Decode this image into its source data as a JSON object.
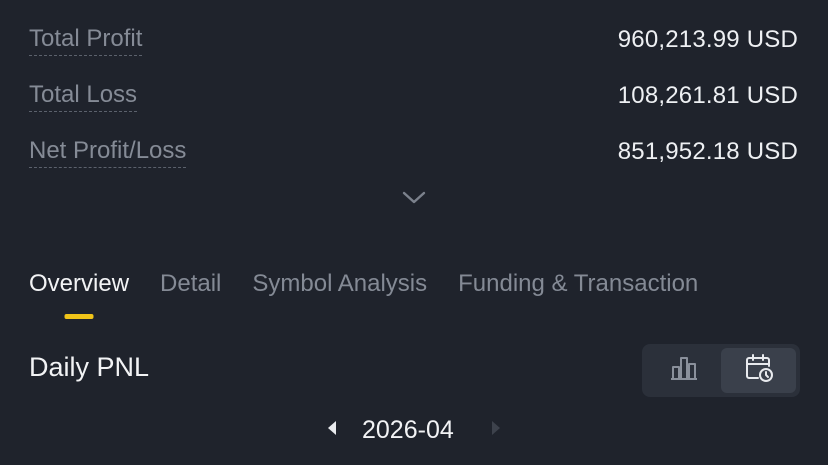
{
  "stats": [
    {
      "label": "Total Profit",
      "value": "960,213.99 USD"
    },
    {
      "label": "Total Loss",
      "value": "108,261.81 USD"
    },
    {
      "label": "Net Profit/Loss",
      "value": "851,952.18 USD"
    }
  ],
  "expand_icon": "chevron-down-icon",
  "tabs": [
    {
      "label": "Overview",
      "active": true
    },
    {
      "label": "Detail",
      "active": false
    },
    {
      "label": "Symbol Analysis",
      "active": false
    },
    {
      "label": "Funding & Transaction",
      "active": false
    }
  ],
  "daily_pnl": {
    "title": "Daily PNL",
    "month": "2026-04",
    "view_toggle": [
      {
        "icon": "bar-chart-icon",
        "active": false
      },
      {
        "icon": "calendar-clock-icon",
        "active": true
      }
    ]
  },
  "colors": {
    "background": "#1f232c",
    "accent": "#f0c419",
    "muted_text": "#848a95",
    "primary_text": "#f2f3f5"
  }
}
